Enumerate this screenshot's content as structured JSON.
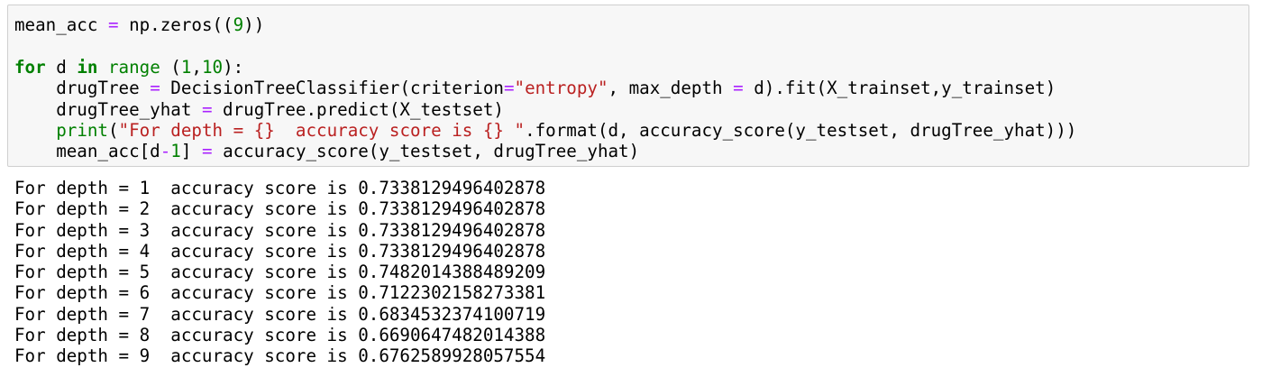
{
  "input_cell": {
    "code_lines": [
      [
        {
          "t": "mean_acc "
        },
        {
          "t": "=",
          "c": "op"
        },
        {
          "t": " np.zeros(("
        },
        {
          "t": "9",
          "c": "num"
        },
        {
          "t": "))"
        }
      ],
      [],
      [
        {
          "t": "for",
          "c": "kw"
        },
        {
          "t": " d "
        },
        {
          "t": "in",
          "c": "kw"
        },
        {
          "t": " "
        },
        {
          "t": "range",
          "c": "bi"
        },
        {
          "t": " ("
        },
        {
          "t": "1",
          "c": "num"
        },
        {
          "t": ","
        },
        {
          "t": "10",
          "c": "num"
        },
        {
          "t": "):"
        }
      ],
      [
        {
          "t": "    drugTree "
        },
        {
          "t": "=",
          "c": "op"
        },
        {
          "t": " DecisionTreeClassifier(criterion"
        },
        {
          "t": "=",
          "c": "op"
        },
        {
          "t": "\"entropy\"",
          "c": "str"
        },
        {
          "t": ", max_depth "
        },
        {
          "t": "=",
          "c": "op"
        },
        {
          "t": " d).fit(X_trainset,y_trainset)"
        }
      ],
      [
        {
          "t": "    drugTree_yhat "
        },
        {
          "t": "=",
          "c": "op"
        },
        {
          "t": " drugTree.predict(X_testset)"
        }
      ],
      [
        {
          "t": "    "
        },
        {
          "t": "print",
          "c": "bi"
        },
        {
          "t": "("
        },
        {
          "t": "\"For depth = {}  accuracy score is {} \"",
          "c": "str"
        },
        {
          "t": ".format(d, accuracy_score(y_testset, drugTree_yhat)))"
        }
      ],
      [
        {
          "t": "    mean_acc[d"
        },
        {
          "t": "-",
          "c": "op"
        },
        {
          "t": "1",
          "c": "num"
        },
        {
          "t": "] "
        },
        {
          "t": "=",
          "c": "op"
        },
        {
          "t": " accuracy_score(y_testset, drugTree_yhat)"
        }
      ]
    ]
  },
  "output_cell": {
    "lines": [
      "For depth = 1  accuracy score is 0.7338129496402878",
      "For depth = 2  accuracy score is 0.7338129496402878",
      "For depth = 3  accuracy score is 0.7338129496402878",
      "For depth = 4  accuracy score is 0.7338129496402878",
      "For depth = 5  accuracy score is 0.7482014388489209",
      "For depth = 6  accuracy score is 0.7122302158273381",
      "For depth = 7  accuracy score is 0.6834532374100719",
      "For depth = 8  accuracy score is 0.6690647482014388",
      "For depth = 9  accuracy score is 0.6762589928057554"
    ]
  },
  "colors": {
    "cell_background": "#f7f7f7",
    "cell_border": "#cfcfcf",
    "keyword": "#008000",
    "operator": "#aa22ff",
    "string": "#ba2121"
  }
}
